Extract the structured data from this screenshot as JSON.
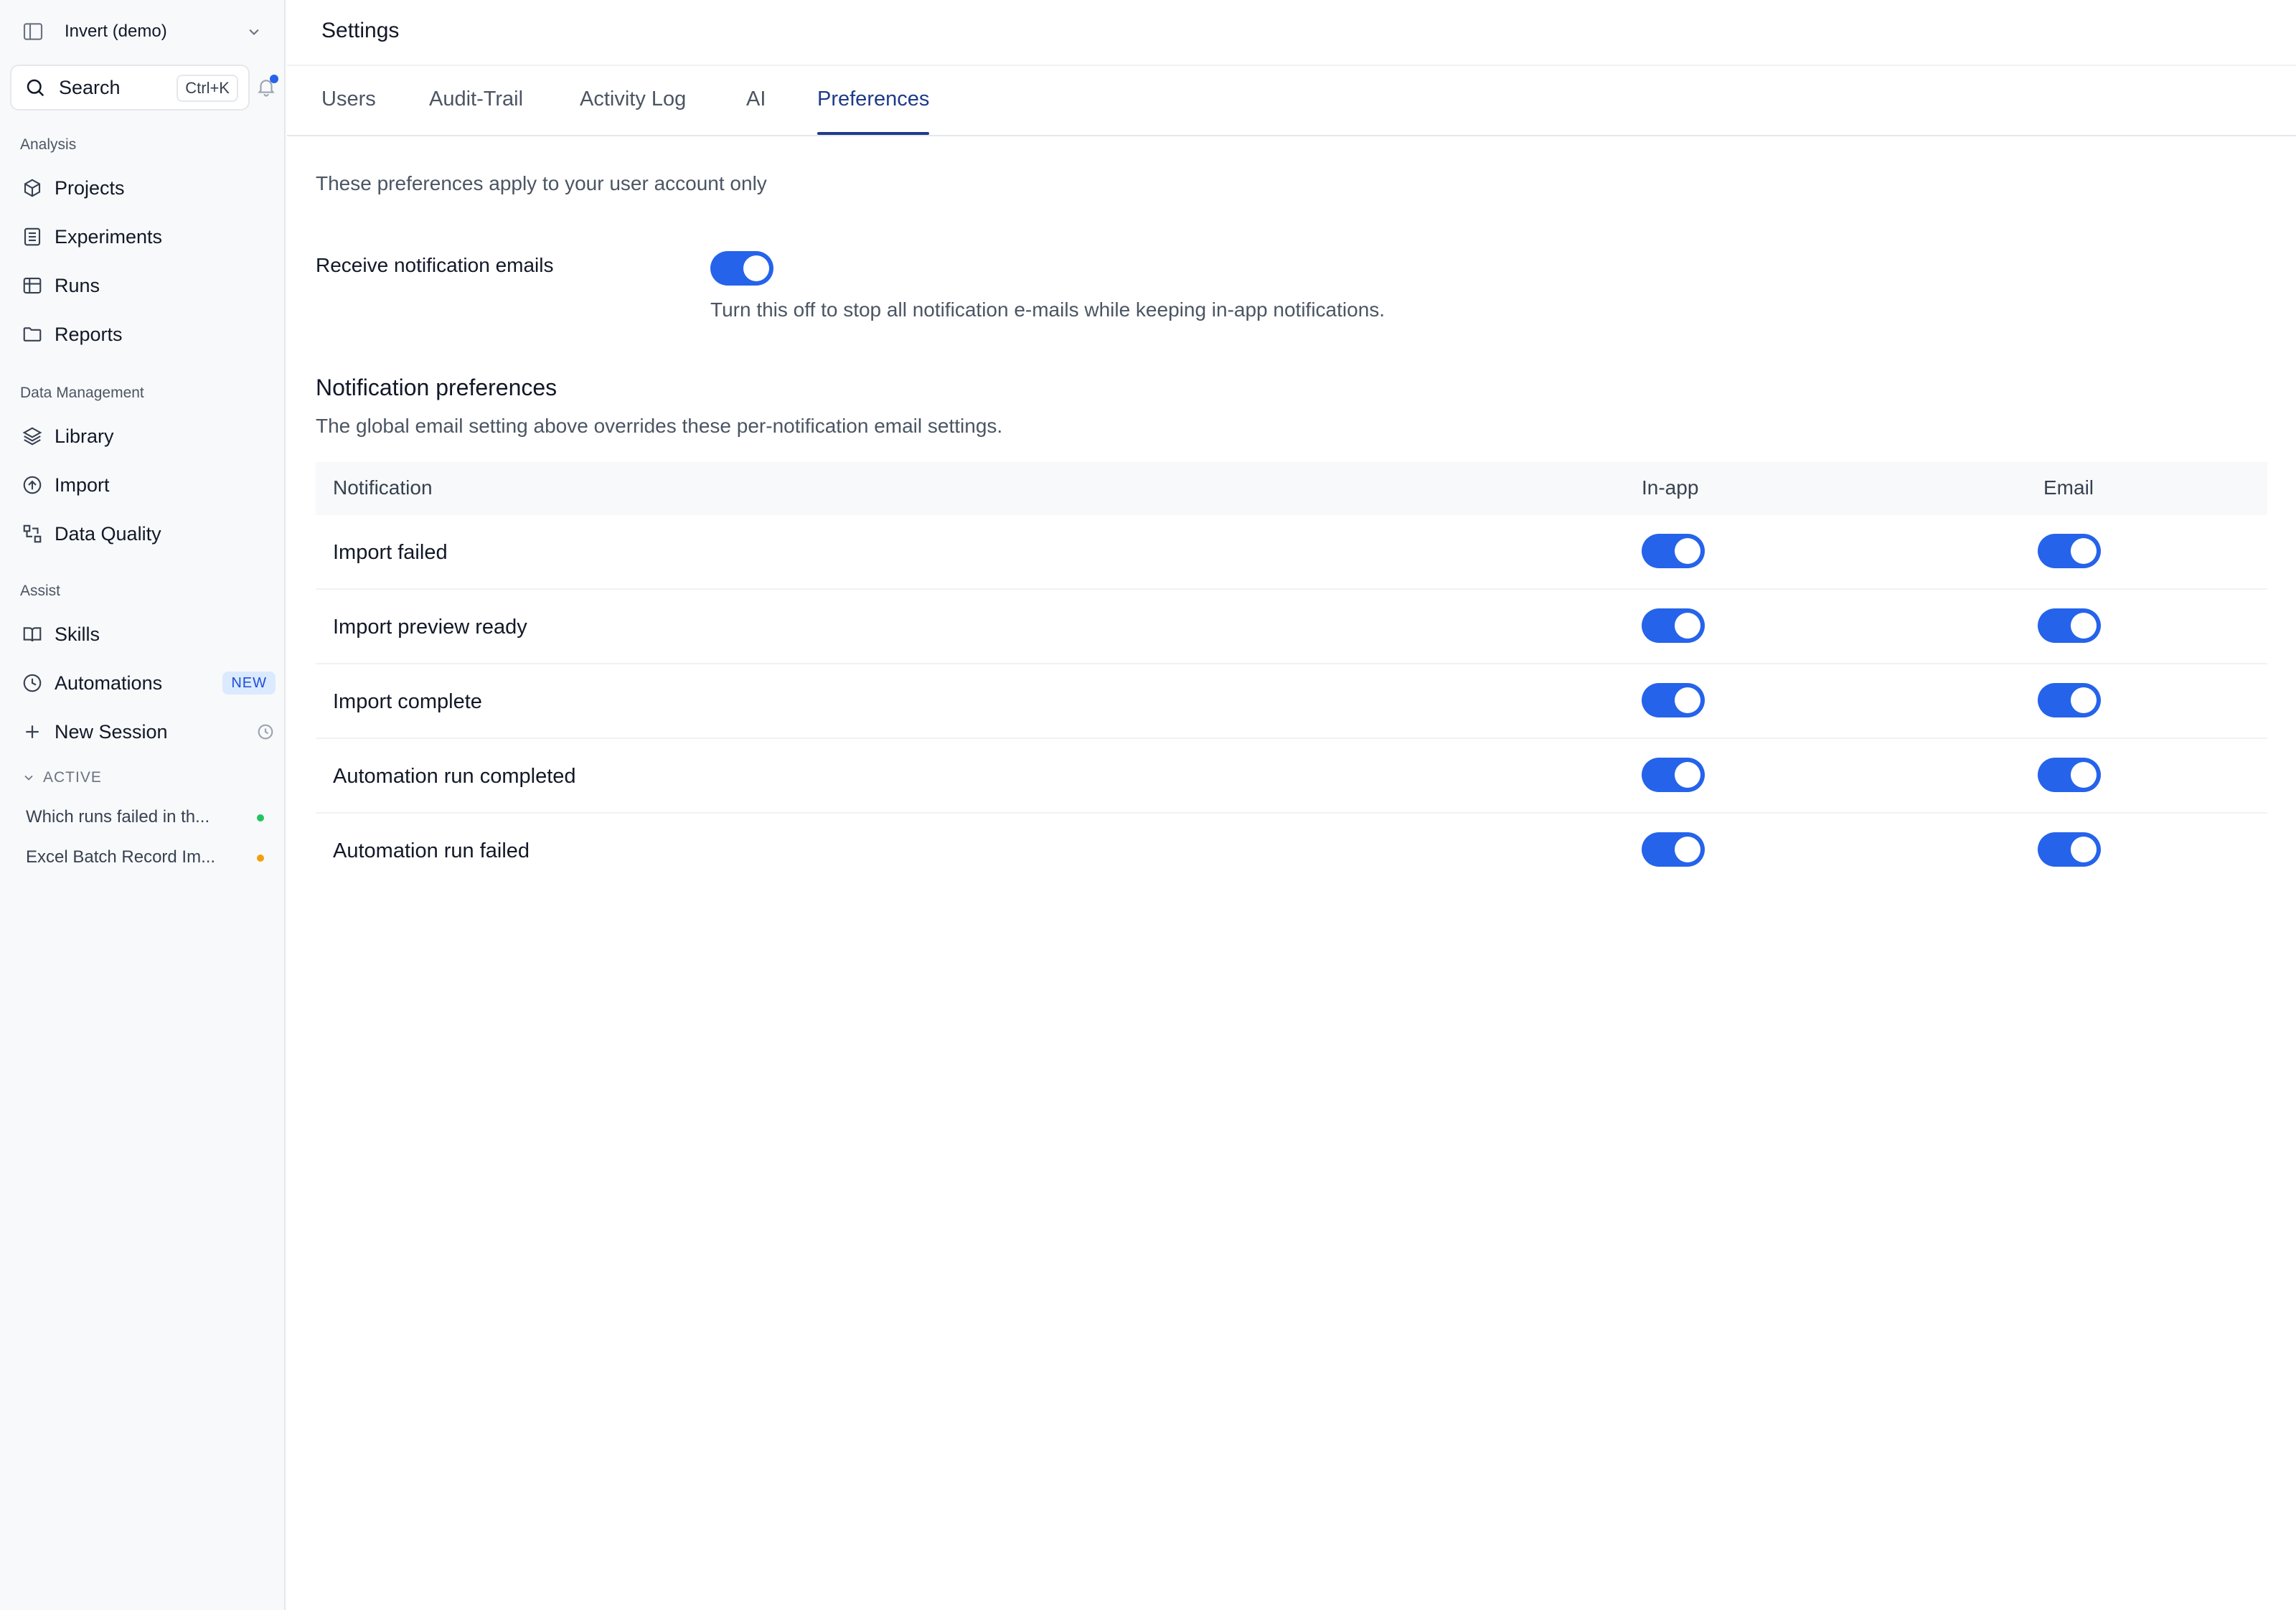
{
  "workspace": {
    "name": "Invert (demo)"
  },
  "search": {
    "label": "Search",
    "shortcut": "Ctrl+K"
  },
  "sidebar": {
    "sections": [
      {
        "label": "Analysis"
      },
      {
        "label": "Data Management"
      },
      {
        "label": "Assist"
      }
    ],
    "items": [
      {
        "label": "Projects",
        "icon": "cube-icon"
      },
      {
        "label": "Experiments",
        "icon": "list-icon"
      },
      {
        "label": "Runs",
        "icon": "table-icon"
      },
      {
        "label": "Reports",
        "icon": "folder-icon"
      },
      {
        "label": "Library",
        "icon": "layers-icon"
      },
      {
        "label": "Import",
        "icon": "upload-icon"
      },
      {
        "label": "Data Quality",
        "icon": "data-quality-icon"
      },
      {
        "label": "Skills",
        "icon": "book-icon"
      },
      {
        "label": "Automations",
        "icon": "clock-icon",
        "badge": "NEW"
      },
      {
        "label": "New Session",
        "icon": "plus-icon"
      }
    ],
    "active_header": "ACTIVE",
    "sessions": [
      {
        "label": "Which runs failed in th...",
        "status_color": "#22c55e"
      },
      {
        "label": "Excel Batch Record Im...",
        "status_color": "#f59e0b"
      }
    ]
  },
  "header": {
    "title": "Settings"
  },
  "tabs": [
    {
      "label": "Users",
      "active": false
    },
    {
      "label": "Audit-Trail",
      "active": false
    },
    {
      "label": "Activity Log",
      "active": false
    },
    {
      "label": "AI",
      "active": false
    },
    {
      "label": "Preferences",
      "active": true
    }
  ],
  "preferences": {
    "intro": "These preferences apply to your user account only",
    "email_toggle": {
      "label": "Receive notification emails",
      "help": "Turn this off to stop all notification e-mails while keeping in-app notifications.",
      "enabled": true
    },
    "notification_prefs": {
      "title": "Notification preferences",
      "subtitle": "The global email setting above overrides these per-notification email settings.",
      "columns": [
        "Notification",
        "In-app",
        "Email"
      ],
      "rows": [
        {
          "name": "Import failed",
          "in_app": true,
          "email": true
        },
        {
          "name": "Import preview ready",
          "in_app": true,
          "email": true
        },
        {
          "name": "Import complete",
          "in_app": true,
          "email": true
        },
        {
          "name": "Automation run completed",
          "in_app": true,
          "email": true
        },
        {
          "name": "Automation run failed",
          "in_app": true,
          "email": true
        }
      ]
    }
  },
  "colors": {
    "accent": "#2563eb",
    "active_tab": "#1e3a8a",
    "sidebar_bg": "#f8f9fb"
  }
}
